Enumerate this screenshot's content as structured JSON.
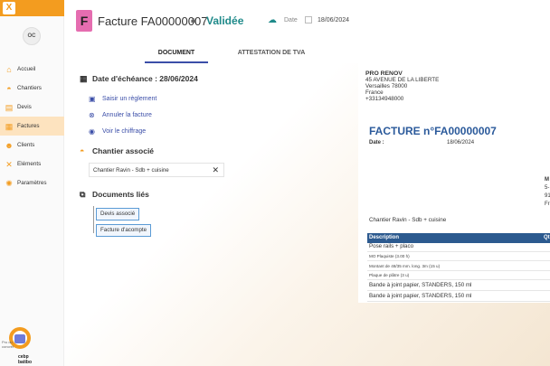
{
  "app": {
    "logo_letter": "X"
  },
  "user": {
    "initials": "OC"
  },
  "sidebar": {
    "items": [
      {
        "label": "Accueil",
        "icon": "home-icon"
      },
      {
        "label": "Chantiers",
        "icon": "hardhat-icon"
      },
      {
        "label": "Devis",
        "icon": "quote-icon"
      },
      {
        "label": "Factures",
        "icon": "invoice-icon",
        "active": true
      },
      {
        "label": "Clients",
        "icon": "users-icon"
      },
      {
        "label": "Eléments",
        "icon": "tools-icon"
      },
      {
        "label": "Paramètres",
        "icon": "gear-icon"
      }
    ],
    "badge_text": "Pro du\nconcrét\nles",
    "badge_brand": "cebp batibo"
  },
  "header": {
    "doc_letter": "F",
    "title": "Facture FA00000007",
    "status": "Validée",
    "date_label": "Date",
    "date_value": "18/06/2024"
  },
  "tabs": [
    "DOCUMENT",
    "ATTESTATION DE TVA"
  ],
  "echeance": {
    "title": "Date d'échéance : 28/06/2024",
    "actions": [
      "Saisir un règlement",
      "Annuler la facture",
      "Voir le chiffrage"
    ]
  },
  "chantier": {
    "title": "Chantier associé",
    "value": "Chantier Ravin - Sdb + cuisine"
  },
  "documents": {
    "title": "Documents liés",
    "items": [
      "Devis associé",
      "Facture d'acompte"
    ]
  },
  "preview": {
    "company": [
      "PRO RENOV",
      "45 AVENUE DE LA LIBERTE",
      "Versailles 78000",
      "France",
      "+33134948000"
    ],
    "title": "FACTURE n°FA00000007",
    "date_label": "Date :",
    "date_value": "18/06/2024",
    "client_cut": [
      "M",
      "5-",
      "91",
      "Fr"
    ],
    "chantier": "Chantier Ravin - Sdb + cuisine",
    "table_header": "Description",
    "table_header_cut": "Qt",
    "rows": [
      "Pose rails + placo",
      "MO Plaquiste (3.00 h)",
      "Montant de 48/35 mm. long. 3m (15 u)",
      "Plaque de plâtre (3 u)",
      "Bande à joint papier, STANDERS, 150 ml",
      "Bande à joint papier, STANDERS, 150 ml"
    ]
  }
}
